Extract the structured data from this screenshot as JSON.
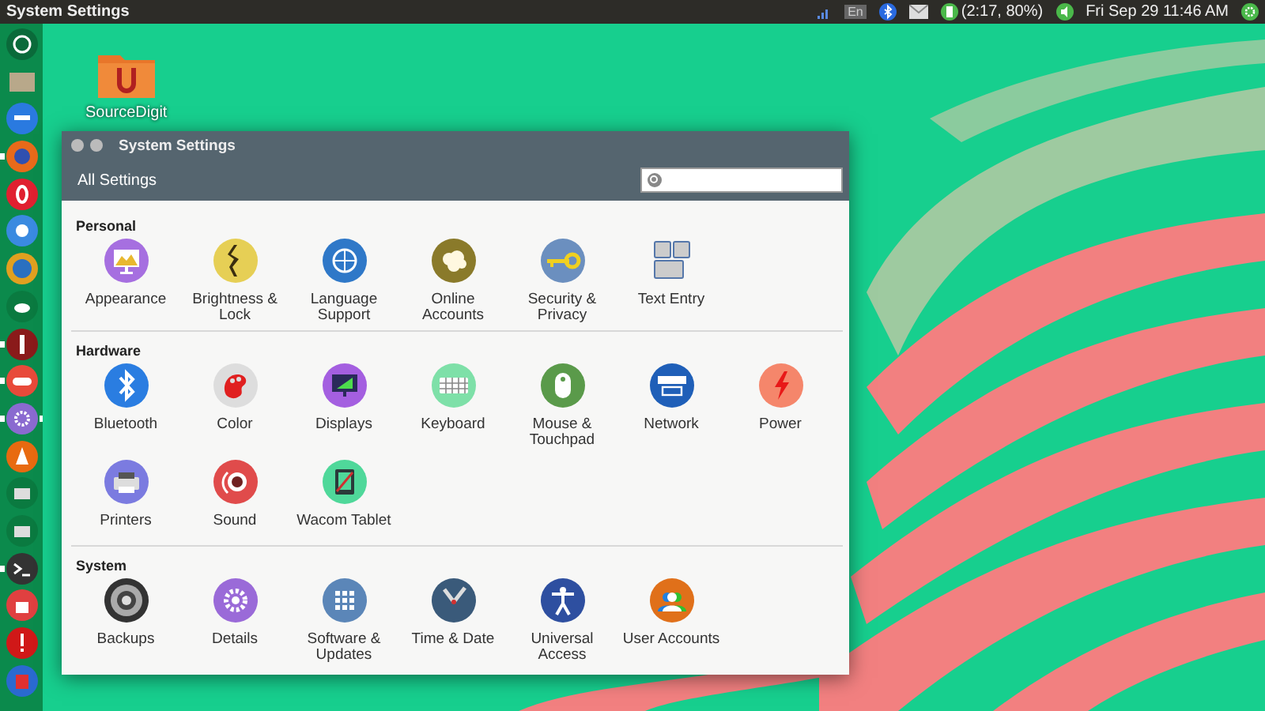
{
  "top_bar": {
    "title": "System Settings",
    "keyboard_layout": "En",
    "battery": "(2:17, 80%)",
    "clock": "Fri Sep 29 11:46 AM"
  },
  "launcher": {
    "items": [
      {
        "running": false,
        "focused": false
      },
      {
        "running": false,
        "focused": false
      },
      {
        "running": false,
        "focused": false
      },
      {
        "running": true,
        "focused": false
      },
      {
        "running": false,
        "focused": false
      },
      {
        "running": false,
        "focused": false
      },
      {
        "running": false,
        "focused": false
      },
      {
        "running": false,
        "focused": false
      },
      {
        "running": true,
        "focused": false
      },
      {
        "running": true,
        "focused": false
      },
      {
        "running": true,
        "focused": true
      },
      {
        "running": false,
        "focused": false
      },
      {
        "running": false,
        "focused": false
      },
      {
        "running": false,
        "focused": false
      },
      {
        "running": true,
        "focused": false
      },
      {
        "running": false,
        "focused": false
      },
      {
        "running": false,
        "focused": false
      },
      {
        "running": false,
        "focused": false
      }
    ]
  },
  "desktop_icons": [
    {
      "label": "SourceDigit"
    }
  ],
  "window": {
    "title": "System Settings",
    "toolbar": {
      "back_label": "All Settings"
    },
    "sections": [
      {
        "title": "Personal",
        "items": [
          {
            "label": "Appearance"
          },
          {
            "label": "Brightness & Lock"
          },
          {
            "label": "Language Support"
          },
          {
            "label": "Online Accounts"
          },
          {
            "label": "Security & Privacy"
          },
          {
            "label": "Text Entry"
          }
        ]
      },
      {
        "title": "Hardware",
        "items": [
          {
            "label": "Bluetooth"
          },
          {
            "label": "Color"
          },
          {
            "label": "Displays"
          },
          {
            "label": "Keyboard"
          },
          {
            "label": "Mouse & Touchpad"
          },
          {
            "label": "Network"
          },
          {
            "label": "Power"
          },
          {
            "label": "Printers"
          },
          {
            "label": "Sound"
          },
          {
            "label": "Wacom Tablet"
          }
        ]
      },
      {
        "title": "System",
        "items": [
          {
            "label": "Backups"
          },
          {
            "label": "Details"
          },
          {
            "label": "Software & Updates"
          },
          {
            "label": "Time & Date"
          },
          {
            "label": "Universal Access"
          },
          {
            "label": "User Accounts"
          }
        ]
      }
    ]
  }
}
